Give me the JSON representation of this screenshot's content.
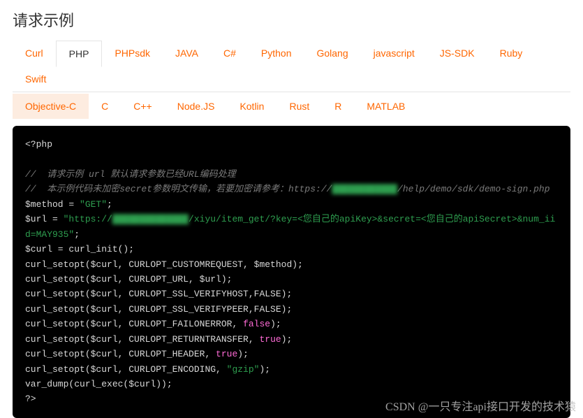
{
  "title": "请求示例",
  "tabs_row1": [
    {
      "id": "curl",
      "label": "Curl"
    },
    {
      "id": "php",
      "label": "PHP"
    },
    {
      "id": "phpsdk",
      "label": "PHPsdk"
    },
    {
      "id": "java",
      "label": "JAVA"
    },
    {
      "id": "csharp",
      "label": "C#"
    },
    {
      "id": "python",
      "label": "Python"
    },
    {
      "id": "golang",
      "label": "Golang"
    },
    {
      "id": "javascript",
      "label": "javascript"
    },
    {
      "id": "jssdk",
      "label": "JS-SDK"
    },
    {
      "id": "ruby",
      "label": "Ruby"
    },
    {
      "id": "swift",
      "label": "Swift"
    }
  ],
  "tabs_row2": [
    {
      "id": "objc",
      "label": "Objective-C"
    },
    {
      "id": "c",
      "label": "C"
    },
    {
      "id": "cpp",
      "label": "C++"
    },
    {
      "id": "nodejs",
      "label": "Node.JS"
    },
    {
      "id": "kotlin",
      "label": "Kotlin"
    },
    {
      "id": "rust",
      "label": "Rust"
    },
    {
      "id": "r",
      "label": "R"
    },
    {
      "id": "matlab",
      "label": "MATLAB"
    }
  ],
  "active_tab": "php",
  "highlight_tab": "objc",
  "code": {
    "open": "<?php",
    "comment1": "//  请求示例 url 默认请求参数已经URL编码处理",
    "comment2a": "//  本示例代码未加密secret参数明文传输，若要加密请参考：https://",
    "comment2_blur": "████████████",
    "comment2b": "/help/demo/sdk/demo-sign.php",
    "l_method_a": "$method = ",
    "l_method_str": "\"GET\"",
    "semi": ";",
    "l_url_a": "$url = ",
    "l_url_str1": "\"https://",
    "l_url_blur": "██████████████",
    "l_url_str2": "/xiyu/item_get/?key=<您自己的apiKey>&secret=<您自己的apiSecret>&num_iid=MAY935\"",
    "l_curl_init": "$curl = curl_init();",
    "l_opt1": "curl_setopt($curl, CURLOPT_CUSTOMREQUEST, $method);",
    "l_opt2": "curl_setopt($curl, CURLOPT_URL, $url);",
    "l_opt3": "curl_setopt($curl, CURLOPT_SSL_VERIFYHOST,FALSE);",
    "l_opt4": "curl_setopt($curl, CURLOPT_SSL_VERIFYPEER,FALSE);",
    "l_opt5a": "curl_setopt($curl, CURLOPT_FAILONERROR, ",
    "false": "false",
    "true": "true",
    "paren_semi": ");",
    "l_opt6a": "curl_setopt($curl, CURLOPT_RETURNTRANSFER, ",
    "l_opt7a": "curl_setopt($curl, CURLOPT_HEADER, ",
    "l_opt8a": "curl_setopt($curl, CURLOPT_ENCODING, ",
    "gzip": "\"gzip\"",
    "l_dump": "var_dump(curl_exec($curl));",
    "close": "?>"
  },
  "watermark": "CSDN @一只专注api接口开发的技术猿"
}
